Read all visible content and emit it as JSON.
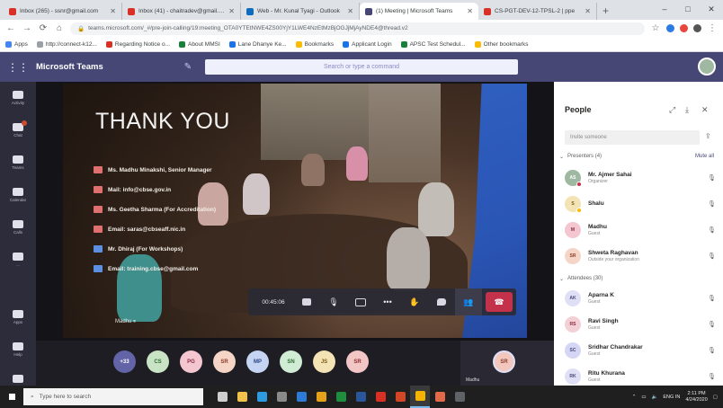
{
  "browser": {
    "tabs": [
      {
        "title": "Inbox (265) - ssnr@gmail.com",
        "color": "#d93025",
        "active": false
      },
      {
        "title": "Inbox (41) - chaitradev@gmail.com",
        "color": "#d93025",
        "active": false
      },
      {
        "title": "Web - Mr. Kunal Tyagi - Outlook",
        "color": "#0f6cbd",
        "active": false
      },
      {
        "title": "(1) Meeting | Microsoft Teams",
        "color": "#464775",
        "active": true
      },
      {
        "title": "CS-PGT-DEV-12-TPSL-2 | ppe",
        "color": "#d93025",
        "active": false
      }
    ],
    "new_tab": "+",
    "window_controls": [
      "–",
      "□",
      "✕"
    ],
    "nav": {
      "back": "←",
      "forward": "→",
      "reload": "⟳",
      "home": "⌂"
    },
    "url": "teams.microsoft.com/_#/pre-join-calling/19:meeting_OTA0YTEtNWE4ZS00YjY1LWE4NzEtMzBjOGJjMjAyNDE4@thread.v2",
    "bookmarks": [
      {
        "label": "Apps",
        "color": "#4285f4"
      },
      {
        "label": "http://connect-k12...",
        "color": "#9aa0a6"
      },
      {
        "label": "Regarding Notice o...",
        "color": "#d93025"
      },
      {
        "label": "About MMSI",
        "color": "#188038"
      },
      {
        "label": "Lane Dhanye Ke...",
        "color": "#1a73e8"
      },
      {
        "label": "Bookmarks",
        "color": "#fbbc04"
      },
      {
        "label": "Applicant Login",
        "color": "#1a73e8"
      },
      {
        "label": "APSC Test Schedul...",
        "color": "#188038"
      },
      {
        "label": "Other bookmarks",
        "color": "#fbbc04"
      }
    ]
  },
  "teams": {
    "app_name": "Microsoft Teams",
    "search_placeholder": "Search or type a command",
    "rail": [
      {
        "label": "Activity"
      },
      {
        "label": "Chat",
        "badge": true
      },
      {
        "label": "Teams"
      },
      {
        "label": "Calendar"
      },
      {
        "label": "Calls"
      },
      {
        "label": "..."
      },
      {
        "label": "Apps"
      },
      {
        "label": "Help"
      },
      {
        "label": "Devices"
      }
    ],
    "slide": {
      "title": "THANK YOU",
      "lines": [
        {
          "text": "Ms. Madhu Minakshi, Senior Manager",
          "icon_color": "#e07070"
        },
        {
          "text": "Mail: info@cbse.gov.in",
          "icon_color": "#e07070"
        },
        {
          "text": "Ms. Geetha Sharma (For Accreditation)",
          "icon_color": "#e07070"
        },
        {
          "text": "Email: saras@cbseaff.nic.in",
          "icon_color": "#e07070"
        },
        {
          "text": "Mr. Dhiraj (For Workshops)",
          "icon_color": "#5c8fe0"
        },
        {
          "text": "Email: training.cbse@gmail.com",
          "icon_color": "#5c8fe0"
        }
      ],
      "speaker": "Madhu ⏸"
    },
    "controls": {
      "time": "00:45:06",
      "buttons": [
        "camera",
        "microphone",
        "share",
        "more",
        "raise-hand",
        "chat",
        "participants"
      ],
      "hangup": "☎"
    },
    "strip": [
      {
        "initials": "+33",
        "bg": "#6264a7",
        "fg": "#fff"
      },
      {
        "initials": "CS",
        "bg": "#c9e4c5",
        "fg": "#2e6b2a"
      },
      {
        "initials": "PG",
        "bg": "#f3c6d0",
        "fg": "#8a2a44"
      },
      {
        "initials": "SR",
        "bg": "#f5d5c5",
        "fg": "#8b3b2a"
      },
      {
        "initials": "MP",
        "bg": "#c5d4f3",
        "fg": "#2a448b"
      },
      {
        "initials": "SN",
        "bg": "#d0ecd4",
        "fg": "#2e6b35"
      },
      {
        "initials": "JS",
        "bg": "#f3e3b5",
        "fg": "#7a5a12"
      },
      {
        "initials": "SR",
        "bg": "#f3c6c6",
        "fg": "#8b2a2a"
      }
    ],
    "self": {
      "initials": "SR",
      "name": "Madhu"
    }
  },
  "people": {
    "title": "People",
    "invite_placeholder": "Invite someone",
    "presenters_label": "Presenters (4)",
    "mute_all": "Mute all",
    "presenters": [
      {
        "name": "Mr. Ajmer Sahai",
        "role": "Organizer",
        "initials": "AS",
        "bg": "#9fb8a1",
        "fg": "#fff",
        "presence": "#c4314b"
      },
      {
        "name": "Shalu",
        "role": "",
        "initials": "S",
        "bg": "#f3e3b5",
        "fg": "#7a5a12",
        "presence": "#fbbc04"
      },
      {
        "name": "Madhu",
        "role": "Guest",
        "initials": "M",
        "bg": "#f3c6d0",
        "fg": "#8a2a44",
        "presence": ""
      },
      {
        "name": "Shweta Raghavan",
        "role": "Outside your organization",
        "initials": "SR",
        "bg": "#f5d5c5",
        "fg": "#8b3b2a",
        "presence": ""
      }
    ],
    "attendees_label": "Attendees (30)",
    "attendees": [
      {
        "name": "Aparna K",
        "role": "Guest",
        "initials": "AK",
        "bg": "#dfe0f5",
        "fg": "#464775"
      },
      {
        "name": "Ravi Singh",
        "role": "Guest",
        "initials": "RS",
        "bg": "#f3d0d5",
        "fg": "#8a2a44"
      },
      {
        "name": "Sridhar Chandrakar",
        "role": "Guest",
        "initials": "SC",
        "bg": "#d5d6f5",
        "fg": "#464775"
      },
      {
        "name": "Ritu Khurana",
        "role": "Guest",
        "initials": "RK",
        "bg": "#dfe0f5",
        "fg": "#464775"
      }
    ]
  },
  "taskbar": {
    "search_placeholder": "Type here to search",
    "apps": [
      {
        "name": "task-view",
        "color": "#cfcfcf"
      },
      {
        "name": "file-explorer",
        "color": "#f0c24c"
      },
      {
        "name": "edge",
        "color": "#2e9ae0"
      },
      {
        "name": "store",
        "color": "#8a8a8a"
      },
      {
        "name": "mail",
        "color": "#2e7bd6"
      },
      {
        "name": "chrome-alt",
        "color": "#e3a21a"
      },
      {
        "name": "excel",
        "color": "#1e8e3e"
      },
      {
        "name": "word",
        "color": "#2b579a"
      },
      {
        "name": "acrobat",
        "color": "#d93025"
      },
      {
        "name": "powerpoint",
        "color": "#d24726"
      },
      {
        "name": "chrome",
        "color": "#f4b400",
        "active": true
      },
      {
        "name": "media-player",
        "color": "#e06a4a"
      },
      {
        "name": "app-extra",
        "color": "#5f6368"
      }
    ],
    "tray": {
      "lang": "ENG IN",
      "time": "2:11 PM",
      "date": "4/24/2020"
    }
  },
  "colors": {
    "teams_purple": "#464775",
    "hangup_red": "#c4314b",
    "rail_bg": "#2d2c3a"
  }
}
